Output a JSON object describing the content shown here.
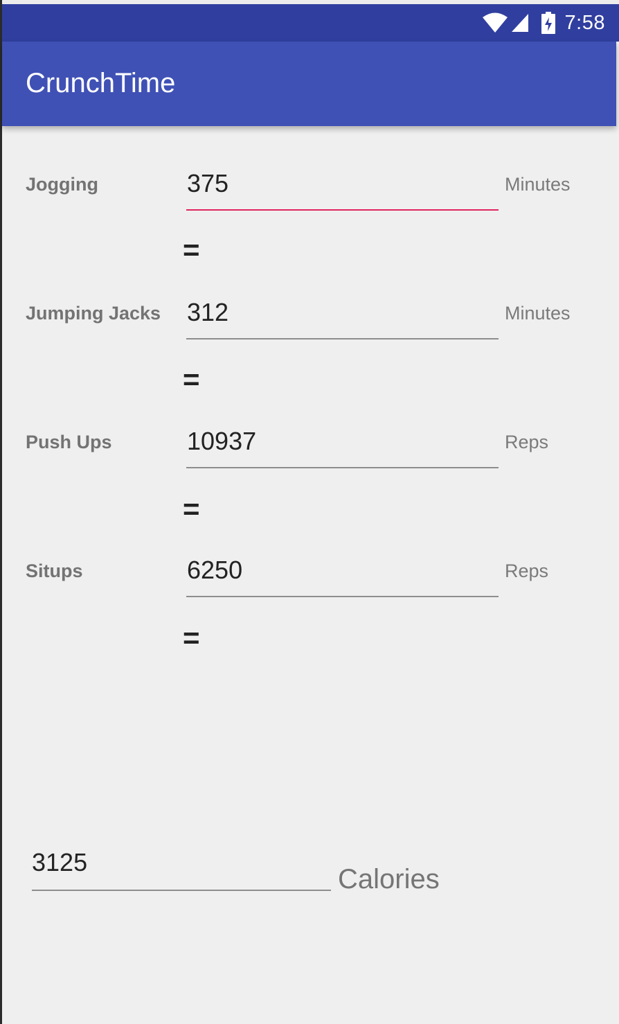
{
  "status_bar": {
    "time": "7:58",
    "icons": [
      "wifi-icon",
      "cell-signal-icon",
      "battery-charging-icon"
    ],
    "color": "#303f9f"
  },
  "app_bar": {
    "title": "CrunchTime",
    "color": "#3f51b5"
  },
  "exercises": [
    {
      "label": "Jogging",
      "value": "375",
      "unit": "Minutes",
      "focused": true
    },
    {
      "label": "Jumping Jacks",
      "value": "312",
      "unit": "Minutes",
      "focused": false
    },
    {
      "label": "Push Ups",
      "value": "10937",
      "unit": "Reps",
      "focused": false
    },
    {
      "label": "Situps",
      "value": "6250",
      "unit": "Reps",
      "focused": false
    }
  ],
  "equals_symbol": "=",
  "total": {
    "value": "3125",
    "unit": "Calories"
  },
  "colors": {
    "background": "#efefef",
    "focus_underline": "#e0245e",
    "underline": "#8d8d8d"
  }
}
